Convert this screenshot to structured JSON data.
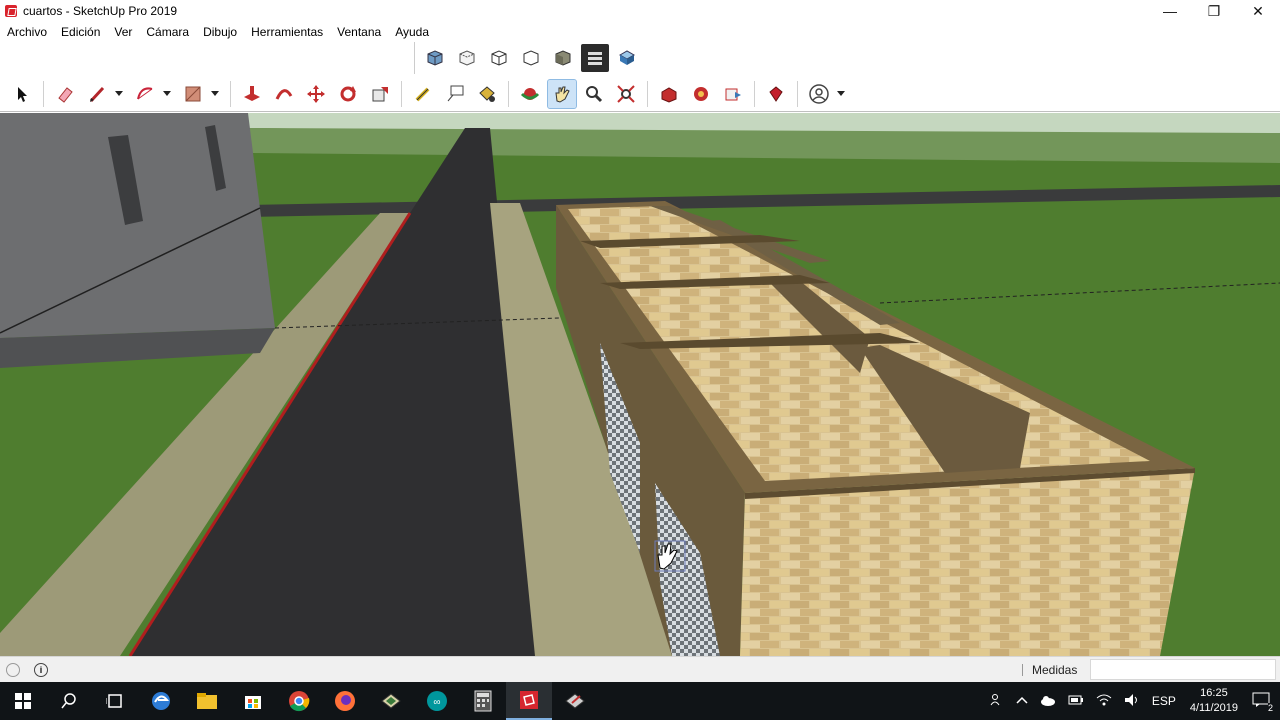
{
  "window": {
    "title": "cuartos - SketchUp Pro 2019",
    "controls": {
      "minimize": "—",
      "restore": "❐",
      "close": "✕"
    }
  },
  "menu": [
    "Archivo",
    "Edición",
    "Ver",
    "Cámara",
    "Dibujo",
    "Herramientas",
    "Ventana",
    "Ayuda"
  ],
  "toolbar_row1": [
    "xray-style-icon",
    "back-edges-style-icon",
    "wireframe-style-icon",
    "hidden-line-style-icon",
    "shaded-style-icon",
    "shaded-textures-style-icon",
    "monochrome-style-icon"
  ],
  "toolbar_row2": {
    "active_tool": "pan-icon"
  },
  "statusbar": {
    "measures_label": "Medidas",
    "measures_value": ""
  },
  "taskbar": {
    "apps": [
      "start-icon",
      "search-icon",
      "task-view-icon",
      "edge-icon",
      "file-explorer-icon",
      "store-icon",
      "chrome-icon",
      "firefox-icon",
      "sketchup-layout-icon",
      "arduino-icon",
      "calculator-icon",
      "sketchup-icon",
      "style-builder-icon"
    ],
    "tray": {
      "language": "ESP",
      "time": "16:25",
      "date": "4/11/2019",
      "notifications": "2"
    }
  },
  "colors": {
    "grass": "#4f7d2f",
    "road": "#2f2f31",
    "sidewalk": "#9d9a78",
    "building": "#5a5b5d",
    "brick": "#d6bf8c",
    "sky": "#c9d9c2"
  }
}
